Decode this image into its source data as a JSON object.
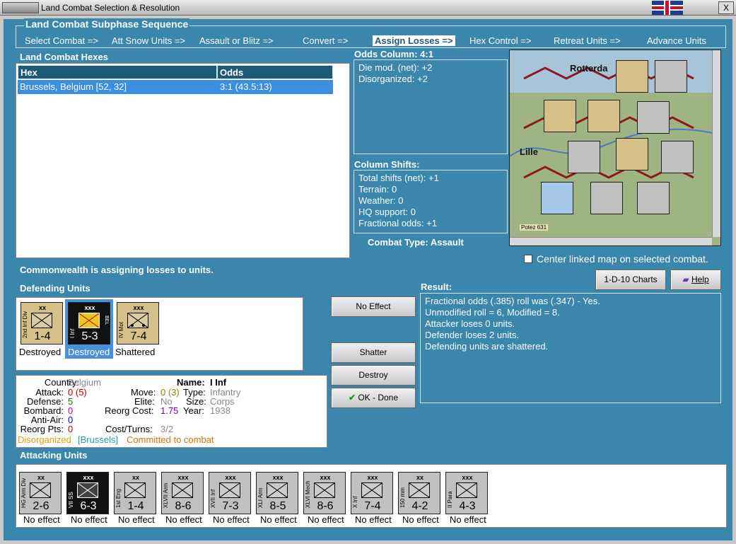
{
  "window": {
    "title": "Land Combat Selection & Resolution",
    "close_label": "X"
  },
  "sequence": {
    "title": "Land Combat Subphase Sequence",
    "steps": [
      "Select Combat =>",
      "Att Snow Units =>",
      "Assault or Blitz =>",
      "Convert =>",
      "Assign Losses =>",
      "Hex Control =>",
      "Retreat Units =>",
      "Advance Units"
    ],
    "active_index": 4
  },
  "hexes": {
    "title": "Land Combat Hexes",
    "columns": [
      "Hex",
      "Odds"
    ],
    "rows": [
      {
        "hex": "Brussels, Belgium [52, 32]",
        "odds": "3:1 (43.5:13)"
      }
    ]
  },
  "odds": {
    "title": "Odds Column: 4:1",
    "lines": [
      "Die mod. (net): +2",
      "Disorganized: +2"
    ]
  },
  "shifts": {
    "title": "Column Shifts:",
    "lines": [
      "Total shifts (net): +1",
      "Terrain: 0",
      "Weather: 0",
      "HQ support: 0",
      "Fractional odds: +1"
    ]
  },
  "combat_type": "Combat Type:  Assault",
  "map": {
    "labels": {
      "rotterdam": "Rotterda",
      "lille": "Lille",
      "potez": "Potez 631"
    },
    "center_checkbox_label": "Center linked map on selected combat.",
    "center_checked": false
  },
  "status_line": "Commonwealth is assigning losses to units.",
  "defending": {
    "title": "Defending Units",
    "units": [
      {
        "name": "2nd Inf Div",
        "size": "xx",
        "strength": "1-4",
        "status": "Destroyed",
        "style": "tan"
      },
      {
        "name": "I Inf",
        "size": "xxx",
        "strength": "5-3",
        "status": "Destroyed",
        "style": "black",
        "tag": "BEL"
      },
      {
        "name": "IV Mot",
        "size": "xxx",
        "strength": "7-4",
        "status": "Shattered",
        "style": "tan"
      }
    ]
  },
  "buttons": {
    "no_effect": "No Effect",
    "shatter": "Shatter",
    "destroy": "Destroy",
    "ok_done": "OK - Done",
    "charts": "1-D-10 Charts",
    "help": "Help"
  },
  "result": {
    "title": "Result:",
    "lines": [
      "Fractional odds (.385) roll was (.347)  - Yes.",
      "Unmodified roll = 6, Modified = 8.",
      "Attacker loses 0 units.",
      "Defender loses 2 units.",
      "Defending units are shattered."
    ]
  },
  "unit_info": {
    "country_label": "Country:",
    "country": "Belgium",
    "attack_label": "Attack:",
    "attack": "0",
    "attack_paren": "(5)",
    "defense_label": "Defense:",
    "defense": "5",
    "bombard_label": "Bombard:",
    "bombard": "0",
    "antiair_label": "Anti-Air:",
    "antiair": "0",
    "reorg_label": "Reorg Pts:",
    "reorg": "0",
    "name_label": "Name:",
    "name": "I Inf",
    "move_label": "Move:",
    "move": "0",
    "move_paren": "(3)",
    "type_label": "Type:",
    "type": "Infantry",
    "elite_label": "Elite:",
    "elite": "No",
    "size_label": "Size:",
    "size": "Corps",
    "reorgcost_label": "Reorg Cost:",
    "reorgcost": "1.75",
    "year_label": "Year:",
    "year": "1938",
    "costturns_label": "Cost/Turns:",
    "costturns": "3/2",
    "disorg": "Disorganized",
    "location": "[Brussels]",
    "committed": "Committed to combat"
  },
  "attacking": {
    "title": "Attacking Units",
    "units": [
      {
        "name": "HG Arm Div",
        "size": "xx",
        "strength": "2-6",
        "status": "No effect",
        "style": "grey"
      },
      {
        "name": "VII SS",
        "size": "xxx",
        "strength": "6-3",
        "status": "No effect",
        "style": "black"
      },
      {
        "name": "1st Eng",
        "size": "xx",
        "strength": "1-4",
        "status": "No effect",
        "style": "grey"
      },
      {
        "name": "XLVII Arm",
        "size": "xxx",
        "strength": "8-6",
        "status": "No effect",
        "style": "grey"
      },
      {
        "name": "XVII Inf",
        "size": "xxx",
        "strength": "7-3",
        "status": "No effect",
        "style": "grey"
      },
      {
        "name": "XLI Arm",
        "size": "xxx",
        "strength": "8-5",
        "status": "No effect",
        "style": "grey"
      },
      {
        "name": "XLVI Mech",
        "size": "xxx",
        "strength": "8-6",
        "status": "No effect",
        "style": "grey"
      },
      {
        "name": "X Inf",
        "size": "xxx",
        "strength": "7-4",
        "status": "No effect",
        "style": "grey"
      },
      {
        "name": "150 mm",
        "size": "xx",
        "strength": "4-2",
        "status": "No effect",
        "style": "grey"
      },
      {
        "name": "II Para",
        "size": "xxx",
        "strength": "4-3",
        "status": "No effect",
        "style": "grey"
      }
    ]
  },
  "colors": {
    "panel_bg": "#3a86ac",
    "active_step": "#ffffff",
    "red": "#c00000",
    "green": "#008000",
    "orange": "#e07000"
  }
}
